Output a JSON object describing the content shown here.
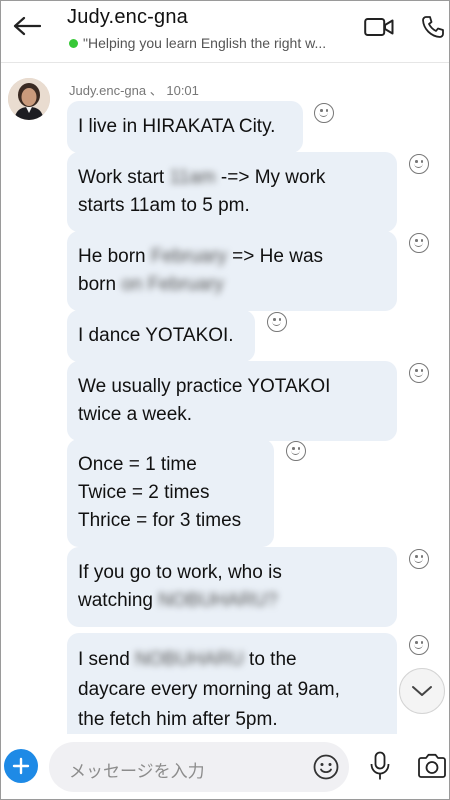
{
  "header": {
    "contact_name": "Judy.enc-gna",
    "mood": "\"Helping you learn English the right w...",
    "presence_color": "#37c837"
  },
  "chat": {
    "sender": "Judy.enc-gna",
    "separator": "、",
    "time": "10:01",
    "messages": [
      {
        "lines": [
          "I live in HIRAKATA City."
        ]
      },
      {
        "line1_a": "Work start ",
        "line1_blur": "11am",
        "line1_b": " -=> My work",
        "line2": "starts 11am to 5 pm."
      },
      {
        "line1_a": "He born ",
        "line1_blur": "February",
        "line1_b": " => He was",
        "line2_a": "born ",
        "line2_blur": "on February"
      },
      {
        "lines": [
          "I dance YOTAKOI."
        ]
      },
      {
        "lines": [
          "We usually practice YOTAKOI",
          "twice a week."
        ]
      },
      {
        "lines": [
          "Once = 1 time",
          "Twice = 2 times",
          "Thrice = for 3 times"
        ]
      },
      {
        "line1": "If you go to work, who is",
        "line2_a": "watching ",
        "line2_blur": "NOBUHARU?"
      },
      {
        "line1_a": "I send ",
        "line1_blur": "NOBUHARU",
        "line1_b": " to the",
        "line2": "daycare every morning at 9am,",
        "line3": "the fetch him after 5pm."
      }
    ]
  },
  "compose": {
    "placeholder": "メッセージを入力"
  },
  "icons": {
    "back": "arrow-left-icon",
    "video": "video-camera-icon",
    "call": "phone-icon",
    "reaction": "smiley-icon",
    "scroll": "chevron-down-icon",
    "add": "plus-icon",
    "emoji": "emoji-icon",
    "mic": "microphone-icon",
    "camera": "camera-icon"
  },
  "colors": {
    "bubble": "#eaf0f7",
    "accent": "#1e8ae6"
  }
}
